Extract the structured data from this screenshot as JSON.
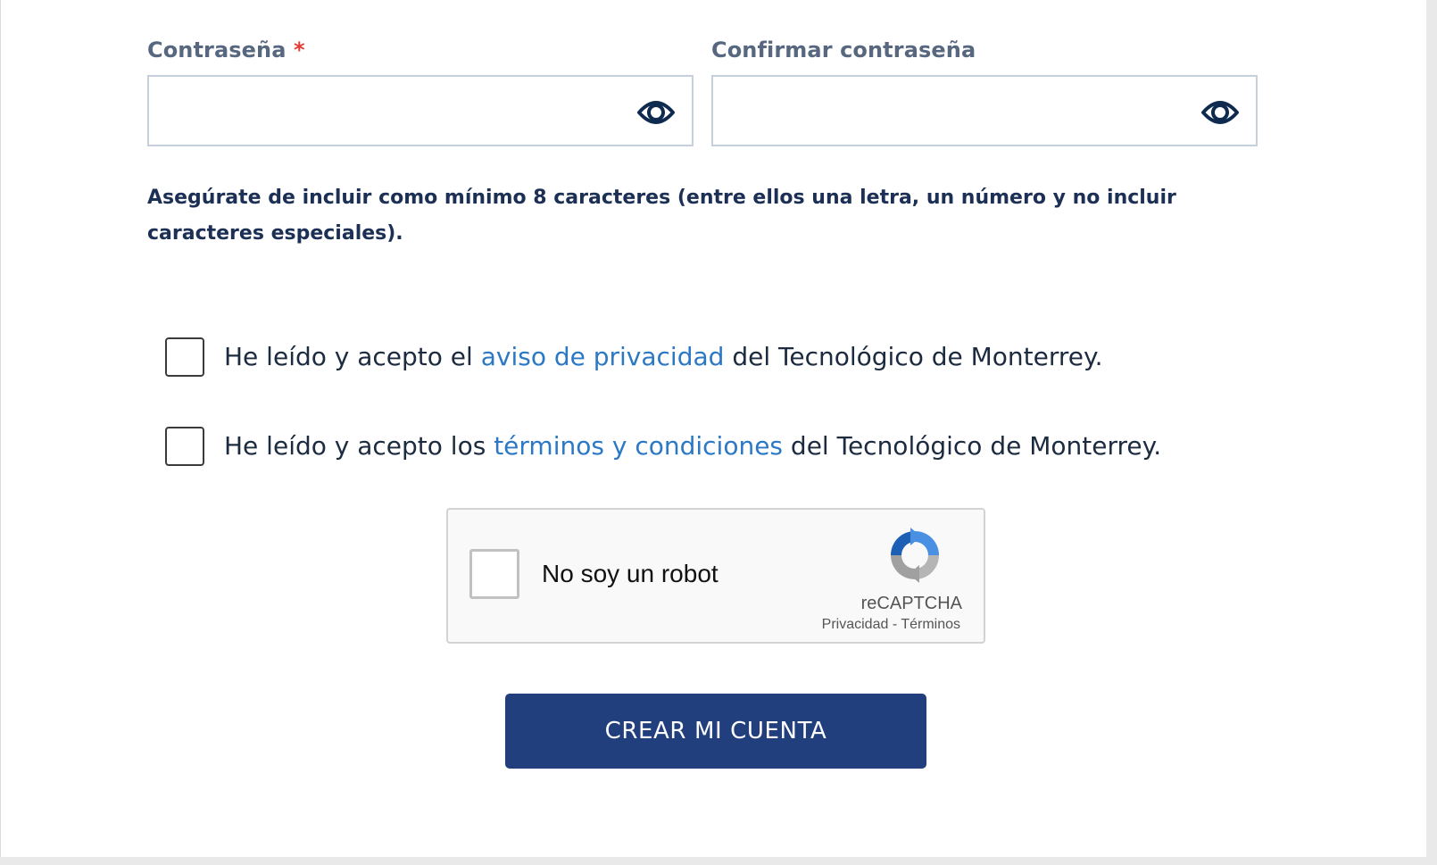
{
  "password": {
    "label": "Contraseña",
    "required_mark": "*",
    "value": ""
  },
  "confirm_password": {
    "label": "Confirmar contraseña",
    "value": ""
  },
  "hint": "Asegúrate de incluir como mínimo 8 caracteres (entre ellos una letra, un número y no incluir caracteres especiales).",
  "privacy_check": {
    "checked": false,
    "prefix": "He leído y acepto el ",
    "link": "aviso de privacidad",
    "suffix": " del Tecnológico de Monterrey."
  },
  "terms_check": {
    "checked": false,
    "prefix": "He leído y acepto los ",
    "link": "términos y condiciones",
    "suffix": " del Tecnológico de Monterrey."
  },
  "recaptcha": {
    "label": "No soy un robot",
    "brand": "reCAPTCHA",
    "privacy": "Privacidad",
    "separator": " - ",
    "terms": "Términos",
    "logo_icon": "recaptcha-logo-icon"
  },
  "submit_label": "CREAR MI CUENTA",
  "icons": {
    "show_password": "eye-icon"
  },
  "colors": {
    "primary": "#213f7d",
    "link": "#2b78c5",
    "label": "#56677f",
    "required": "#e53935",
    "hint": "#1c2f55"
  }
}
